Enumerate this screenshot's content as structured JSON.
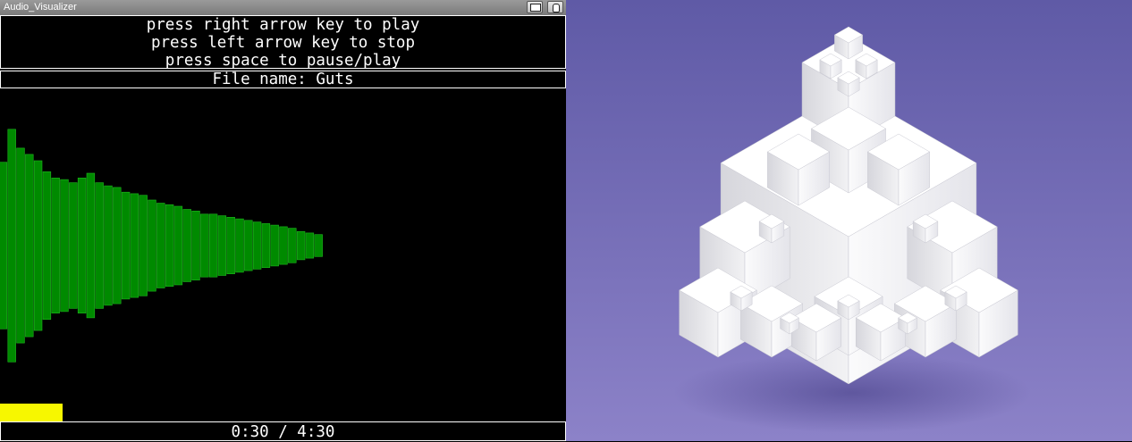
{
  "window": {
    "title": "Audio_Visualizer"
  },
  "instructions": [
    "press right arrow key to play",
    "press left arrow key to stop",
    "press space to pause/play"
  ],
  "file": {
    "label": "File name: Guts"
  },
  "playback": {
    "time_display": "0:30 / 4:30",
    "progress": 0.11
  },
  "colors": {
    "bar_fill": "#008a00",
    "bar_edge": "#1fb61f",
    "progress": "#f7f700",
    "background": "#000000",
    "text": "#ffffff",
    "fractal_background_top": "#5f5aa6",
    "fractal_background_bottom": "#8c82c8"
  },
  "visualizer": {
    "bar_amplitudes": [
      0.53,
      0.74,
      0.62,
      0.58,
      0.54,
      0.47,
      0.43,
      0.42,
      0.4,
      0.43,
      0.46,
      0.4,
      0.38,
      0.37,
      0.34,
      0.33,
      0.32,
      0.29,
      0.27,
      0.26,
      0.25,
      0.23,
      0.22,
      0.2,
      0.2,
      0.19,
      0.18,
      0.17,
      0.16,
      0.15,
      0.14,
      0.13,
      0.12,
      0.11,
      0.09,
      0.08,
      0.07
    ]
  },
  "fractal": {
    "icon": "menger-sponge-render"
  }
}
